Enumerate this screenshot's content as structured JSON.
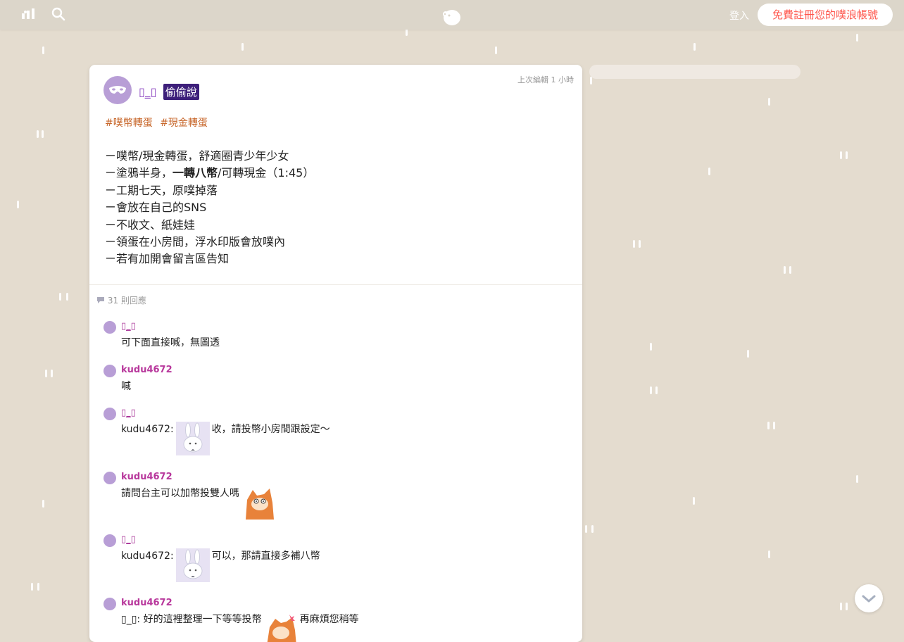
{
  "topbar": {
    "login_label": "登入",
    "signup_label": "免費註冊您的噗浪帳號",
    "icons": [
      "stats-icon",
      "search-icon",
      "plurk-logo"
    ]
  },
  "post": {
    "author": "▯_▯",
    "qualifier": "偷偷說",
    "edited": "上次編輯 1 小時",
    "tags": [
      "#噗幣轉蛋",
      "#現金轉蛋"
    ],
    "lines": [
      "ㄧ噗幣/現金轉蛋，舒適圈青少年少女",
      "ㄧ塗鴉半身，",
      "ㄧ工期七天，原噗掉落",
      "ㄧ會放在自己的SNS",
      "ㄧ不收文、紙娃娃",
      "ㄧ領蛋在小房間，浮水印版會放噗內",
      "ㄧ若有加開會留言區告知"
    ],
    "line2_bold": "一轉八幣",
    "line2_rest": "/可轉現金（1:45）",
    "response_count": "31 則回應"
  },
  "responses": [
    {
      "who": "▯_▯",
      "text": "可下面直接喊，無圖透"
    },
    {
      "who": "kudu4672",
      "text": "喊"
    },
    {
      "who": "▯_▯",
      "prefix": "kudu4672:",
      "text": "收，請投幣小房間跟設定～"
    },
    {
      "who": "kudu4672",
      "text": "請問台主可以加幣投雙人嗎"
    },
    {
      "who": "▯_▯",
      "prefix": "kudu4672:",
      "text": "可以，那請直接多補八幣"
    },
    {
      "who": "kudu4672",
      "prefix": "▯_▯:",
      "text": "好的這裡整理一下等等投幣",
      "text2": "再麻煩您稍等"
    }
  ],
  "colors": {
    "background": "#e4dccf",
    "accent": "#ff574d",
    "author": "#8a43c0",
    "qualifier_bg": "#3d1f7a",
    "tag": "#c7662a"
  }
}
